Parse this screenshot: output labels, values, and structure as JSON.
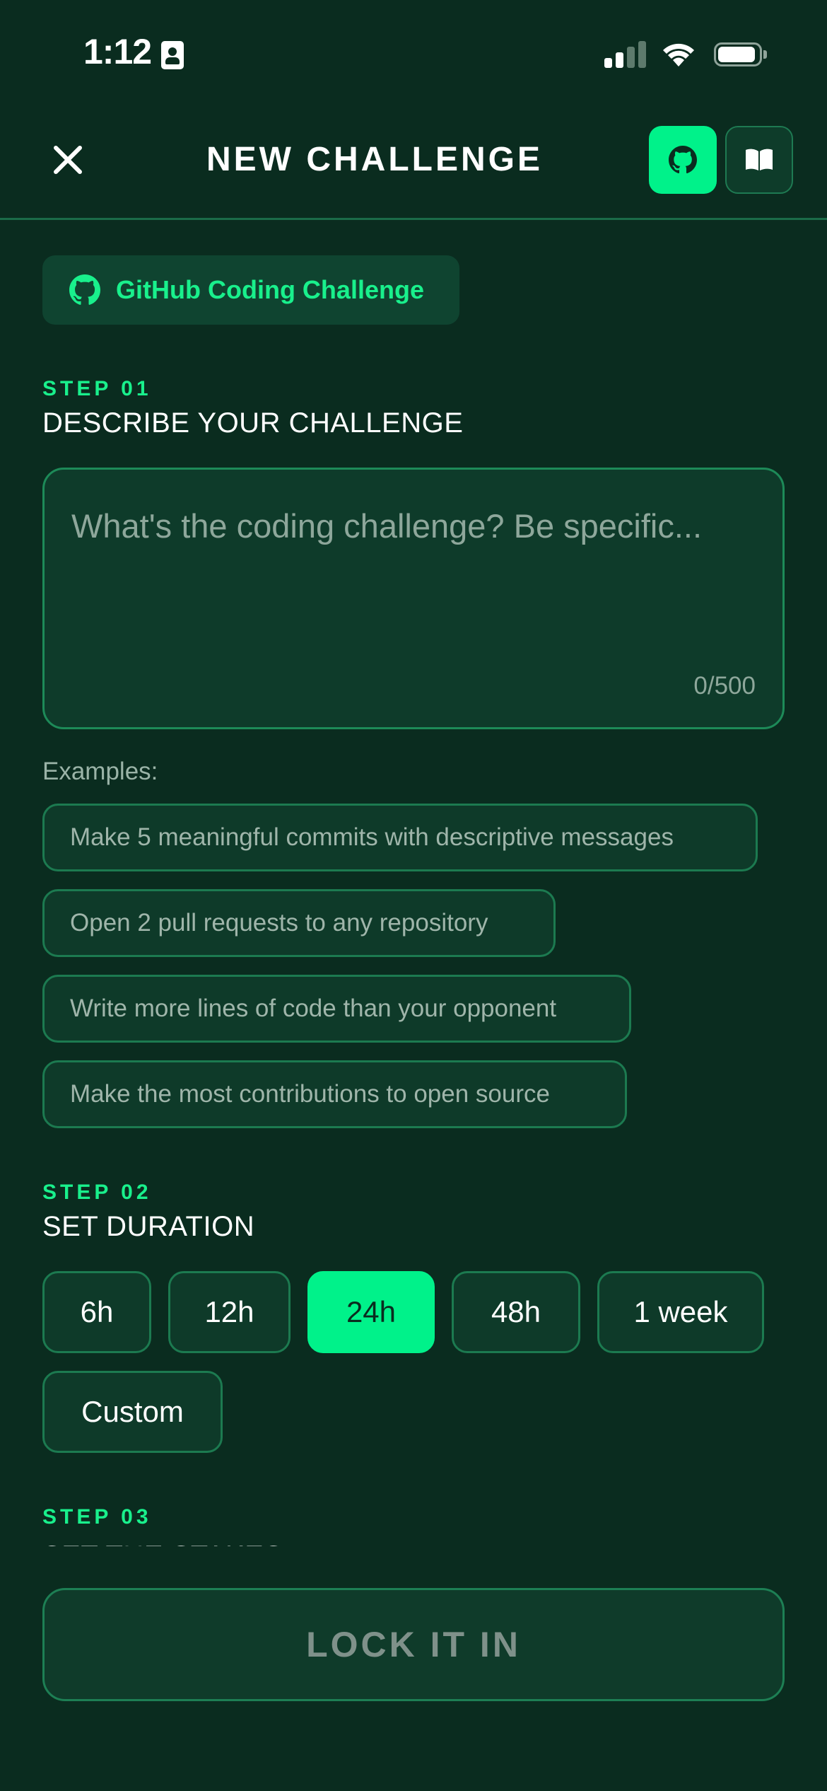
{
  "status_bar": {
    "time": "1:12"
  },
  "header": {
    "title": "NEW CHALLENGE",
    "close_icon": "close-icon",
    "github_icon": "github-icon",
    "book_icon": "book-icon"
  },
  "mode": {
    "label": "GitHub Coding Challenge",
    "icon": "github-icon"
  },
  "step1": {
    "number": "STEP 01",
    "title": "DESCRIBE YOUR CHALLENGE",
    "placeholder": "What's the coding challenge? Be specific...",
    "char_count": "0/500",
    "examples_label": "Examples:",
    "examples": [
      "Make 5 meaningful commits with descriptive messages",
      "Open 2 pull requests to any repository",
      "Write more lines of code than your opponent",
      "Make the most contributions to open source"
    ]
  },
  "step2": {
    "number": "STEP 02",
    "title": "SET DURATION",
    "options": [
      "6h",
      "12h",
      "24h",
      "48h",
      "1 week",
      "Custom"
    ],
    "selected": "24h"
  },
  "step3": {
    "number": "STEP 03",
    "title": "SET THE STAKES"
  },
  "submit_label": "LOCK IT IN",
  "colors": {
    "background": "#0a2c1f",
    "accent": "#00f28a",
    "border": "#1c7a50",
    "muted_text": "#9fb5aa"
  }
}
